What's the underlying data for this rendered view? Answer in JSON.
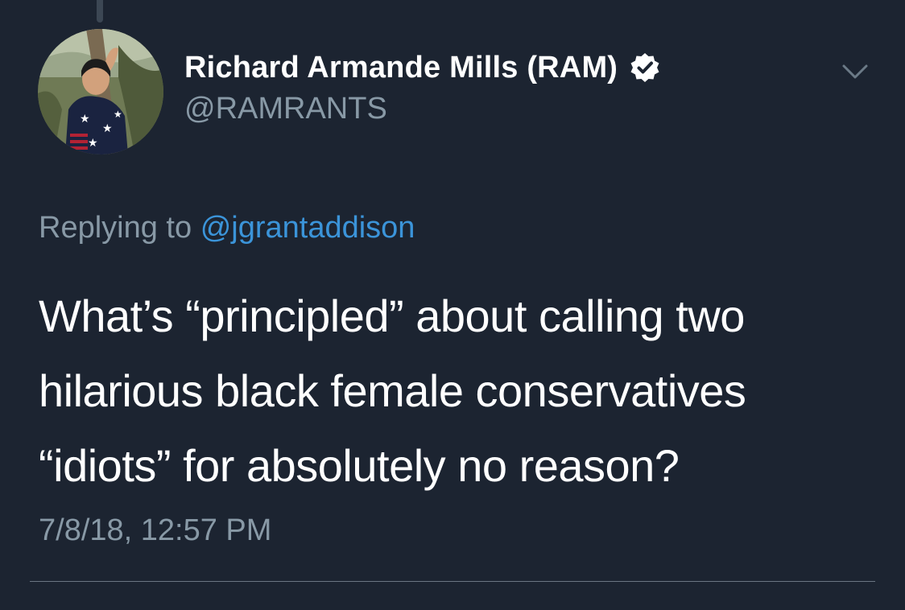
{
  "tweet": {
    "display_name": "Richard Armande Mills (RAM)",
    "handle": "@RAMRANTS",
    "verified": true,
    "replying_prefix": "Replying to",
    "replying_to": "@jgrantaddison",
    "text": "What’s “principled” about calling two hilarious black female conservatives “idiots” for absolutely no reason?",
    "timestamp": "7/8/18, 12:57 PM"
  },
  "icons": {
    "verified": "verified-badge-icon",
    "menu": "chevron-down-icon"
  },
  "colors": {
    "background": "#1c2431",
    "secondary_text": "#8899a6",
    "link": "#3b94d9",
    "primary_text": "#ffffff"
  }
}
